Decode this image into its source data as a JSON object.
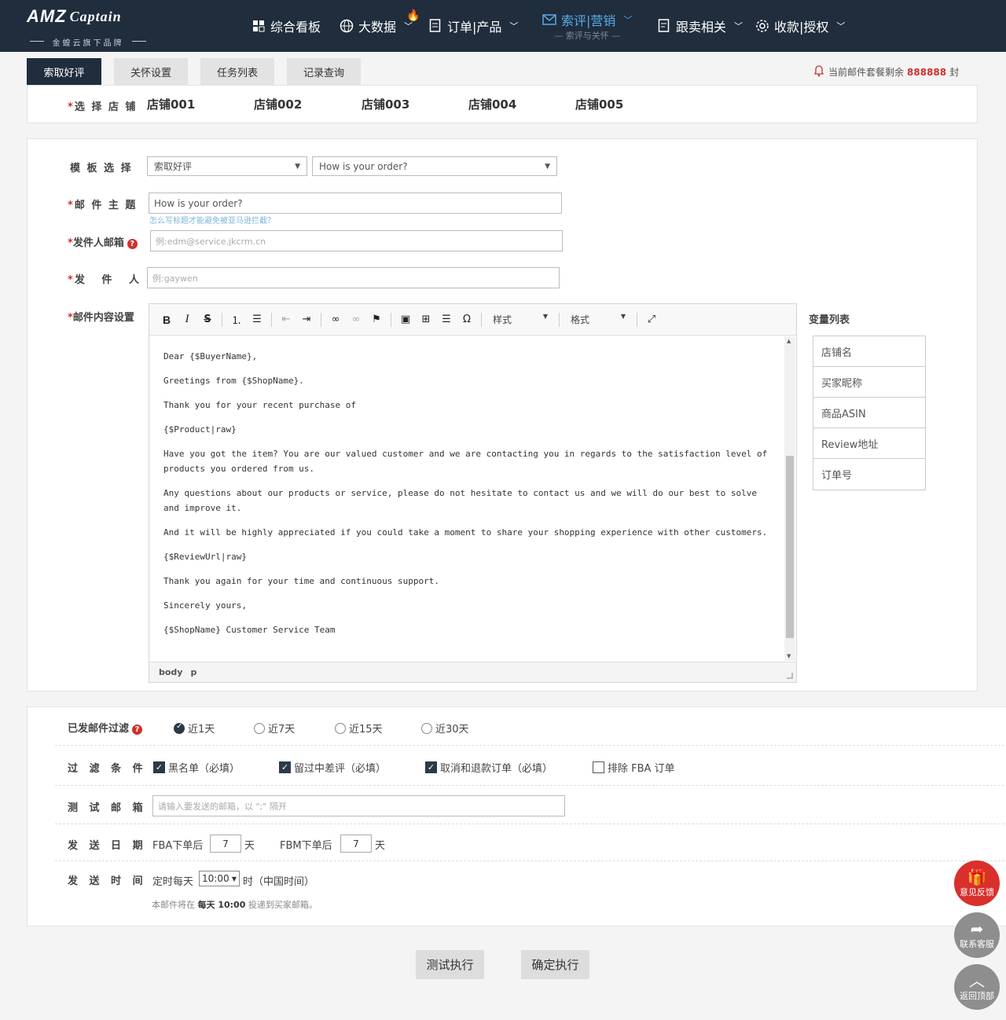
{
  "logo": {
    "main": "AMZ",
    "captain": "Captain",
    "sub": "金蝗云旗下品牌"
  },
  "nav": {
    "items": [
      {
        "label": "综合看板"
      },
      {
        "label": "大数据"
      },
      {
        "label": "订单|产品"
      },
      {
        "label": "索评|营销",
        "sub": "— 索评与关怀 —"
      },
      {
        "label": "跟卖相关"
      },
      {
        "label": "收款|授权"
      }
    ]
  },
  "tabs": [
    "索取好评",
    "关怀设置",
    "任务列表",
    "记录查询"
  ],
  "quota": {
    "prefix": "当前邮件套餐剩余",
    "count": "888888",
    "suffix": "封"
  },
  "shop_select": {
    "label": "选 择 店 铺",
    "shops": [
      "店铺001",
      "店铺002",
      "店铺003",
      "店铺004",
      "店铺005"
    ]
  },
  "form": {
    "template_label": "模 板 选 择",
    "template_value": "索取好评",
    "template_sub_value": "How is your order?",
    "subject_label": "邮 件 主 题",
    "subject_value": "How is your order?",
    "subject_hint": "怎么写标题才能避免被亚马逊拦截？",
    "sender_email_label": "发件人邮箱",
    "sender_email_placeholder": "例:edm@service.jkcrm.cn",
    "sender_label": "发   件   人",
    "sender_placeholder": "例:gaywen",
    "content_label": "邮件内容设置"
  },
  "editor": {
    "style_label": "样式",
    "format_label": "格式",
    "lines": [
      "Dear {$BuyerName},",
      "Greetings from {$ShopName}.",
      "Thank you for your recent purchase of",
      "{$Product|raw}",
      "Have you got the item? You are our valued customer and we are contacting you in regards to the satisfaction level of products you ordered from us.",
      "Any questions about our products or service, please do not hesitate to contact us and we will do our best to solve and improve it.",
      "And it will be highly appreciated if you could take a moment to share your shopping experience with other customers.",
      "{$ReviewUrl|raw}",
      "Thank you again for your time and continuous support.",
      "Sincerely yours,",
      "{$ShopName} Customer Service Team"
    ],
    "path": [
      "body",
      "p"
    ]
  },
  "variables": {
    "title": "变量列表",
    "items": [
      "店铺名",
      "买家昵称",
      "商品ASIN",
      "Review地址",
      "订单号"
    ]
  },
  "filter": {
    "sent_label": "已发邮件过滤",
    "options": [
      "近1天",
      "近7天",
      "近15天",
      "近30天"
    ],
    "conditions_label": "过 滤 条 件",
    "conditions": [
      {
        "label": "黑名单（必填）",
        "checked": true
      },
      {
        "label": "留过中差评（必填）",
        "checked": true
      },
      {
        "label": "取消和退款订单（必填）",
        "checked": true
      },
      {
        "label": "排除 FBA 订单",
        "checked": false
      }
    ],
    "test_label": "测 试 邮 箱",
    "test_placeholder": "请输入要发送的邮箱，以 \";\" 隔开",
    "date_label": "发 送 日 期",
    "fba_prefix": "FBA下单后",
    "fba_days": "7",
    "fbm_prefix": "FBM下单后",
    "fbm_days": "7",
    "day_unit": "天",
    "time_label": "发 送 时 间",
    "time_prefix": "定时每天",
    "time_value": "10:00",
    "time_suffix": "时（中国时间）",
    "note_prefix": "本邮件将在",
    "note_bold": "每天 10:00",
    "note_suffix": "投递到买家邮箱。"
  },
  "buttons": {
    "test": "测试执行",
    "confirm": "确定执行"
  },
  "floats": {
    "feedback": "意见反馈",
    "service": "联系客服",
    "top": "返回顶部"
  }
}
